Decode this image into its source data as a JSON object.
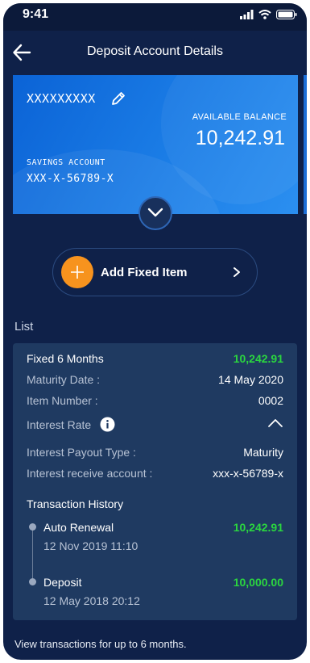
{
  "status_bar": {
    "time": "9:41"
  },
  "header": {
    "title": "Deposit Account Details"
  },
  "card": {
    "account_name": "XXXXXXXXX",
    "balance_label": "AVAILABLE BALANCE",
    "balance_value": "10,242.91",
    "account_type": "SAVINGS ACCOUNT",
    "account_number": "XXX-X-56789-X"
  },
  "add_button": {
    "label": "Add Fixed Item"
  },
  "list": {
    "heading": "List",
    "item": {
      "title": "Fixed 6 Months",
      "amount": "10,242.91",
      "rows": [
        {
          "label": "Maturity Date :",
          "value": "14 May 2020"
        },
        {
          "label": "Item Number :",
          "value": "0002"
        }
      ],
      "interest_rate_label": "Interest Rate",
      "details": [
        {
          "label": "Interest Payout Type :",
          "value": "Maturity"
        },
        {
          "label": "Interest receive account :",
          "value": "xxx-x-56789-x"
        }
      ],
      "history_heading": "Transaction History",
      "transactions": [
        {
          "type": "Auto Renewal",
          "date": "12 Nov 2019 11:10",
          "amount": "10,242.91"
        },
        {
          "type": "Deposit",
          "date": "12 May 2018 20:12",
          "amount": "10,000.00"
        }
      ]
    }
  },
  "footer": {
    "note": "View transactions for up to 6 months."
  },
  "colors": {
    "background": "#0f2149",
    "panel": "#1f3a61",
    "accent": "#f7931e",
    "positive": "#2bd63f",
    "card": "#1b7de6"
  }
}
